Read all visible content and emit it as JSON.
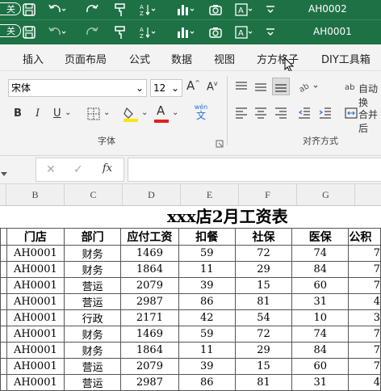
{
  "window": {
    "title_back": "AH0002",
    "title_front": "AH0001",
    "close_label": "关"
  },
  "menu": {
    "items": [
      "插入",
      "页面布局",
      "公式",
      "数据",
      "视图",
      "方方格子",
      "DIY工具箱"
    ]
  },
  "ribbon": {
    "font_name": "宋体",
    "font_size": "12",
    "bold": "B",
    "italic": "I",
    "underline": "U",
    "increase_font": "A",
    "decrease_font": "A",
    "wen_top": "wén",
    "wen_bottom": "文",
    "font_color_letter": "A",
    "font_group_label": "字体",
    "align_group_label": "对齐方式",
    "wrap_label": "自动换",
    "merge_label": "合并后"
  },
  "formula_bar": {
    "fx": "fx",
    "value": ""
  },
  "columns": [
    "B",
    "C",
    "D",
    "E",
    "F",
    "G"
  ],
  "sheet": {
    "title": "xxx店2月工资表",
    "headers": [
      "门店",
      "部门",
      "应付工资",
      "扣餐",
      "社保",
      "医保",
      "公积"
    ],
    "rows": [
      [
        "AH0001",
        "财务",
        "1469",
        "59",
        "72",
        "74",
        "7"
      ],
      [
        "AH0001",
        "财务",
        "1864",
        "11",
        "29",
        "84",
        "7"
      ],
      [
        "AH0001",
        "营运",
        "2079",
        "39",
        "15",
        "60",
        "7"
      ],
      [
        "AH0001",
        "营运",
        "2987",
        "86",
        "81",
        "31",
        "4"
      ],
      [
        "AH0001",
        "行政",
        "2171",
        "42",
        "54",
        "10",
        "3"
      ],
      [
        "AH0001",
        "财务",
        "1469",
        "59",
        "72",
        "74",
        "7"
      ],
      [
        "AH0001",
        "财务",
        "1864",
        "11",
        "29",
        "84",
        "7"
      ],
      [
        "AH0001",
        "营运",
        "2079",
        "39",
        "15",
        "60",
        "7"
      ],
      [
        "AH0001",
        "营运",
        "2987",
        "86",
        "81",
        "31",
        "4"
      ]
    ]
  },
  "colors": {
    "titlebar": "#1e7145",
    "ribbon": "#f3f3f3",
    "highlight": "#ffe600",
    "font_color": "#e02020"
  }
}
